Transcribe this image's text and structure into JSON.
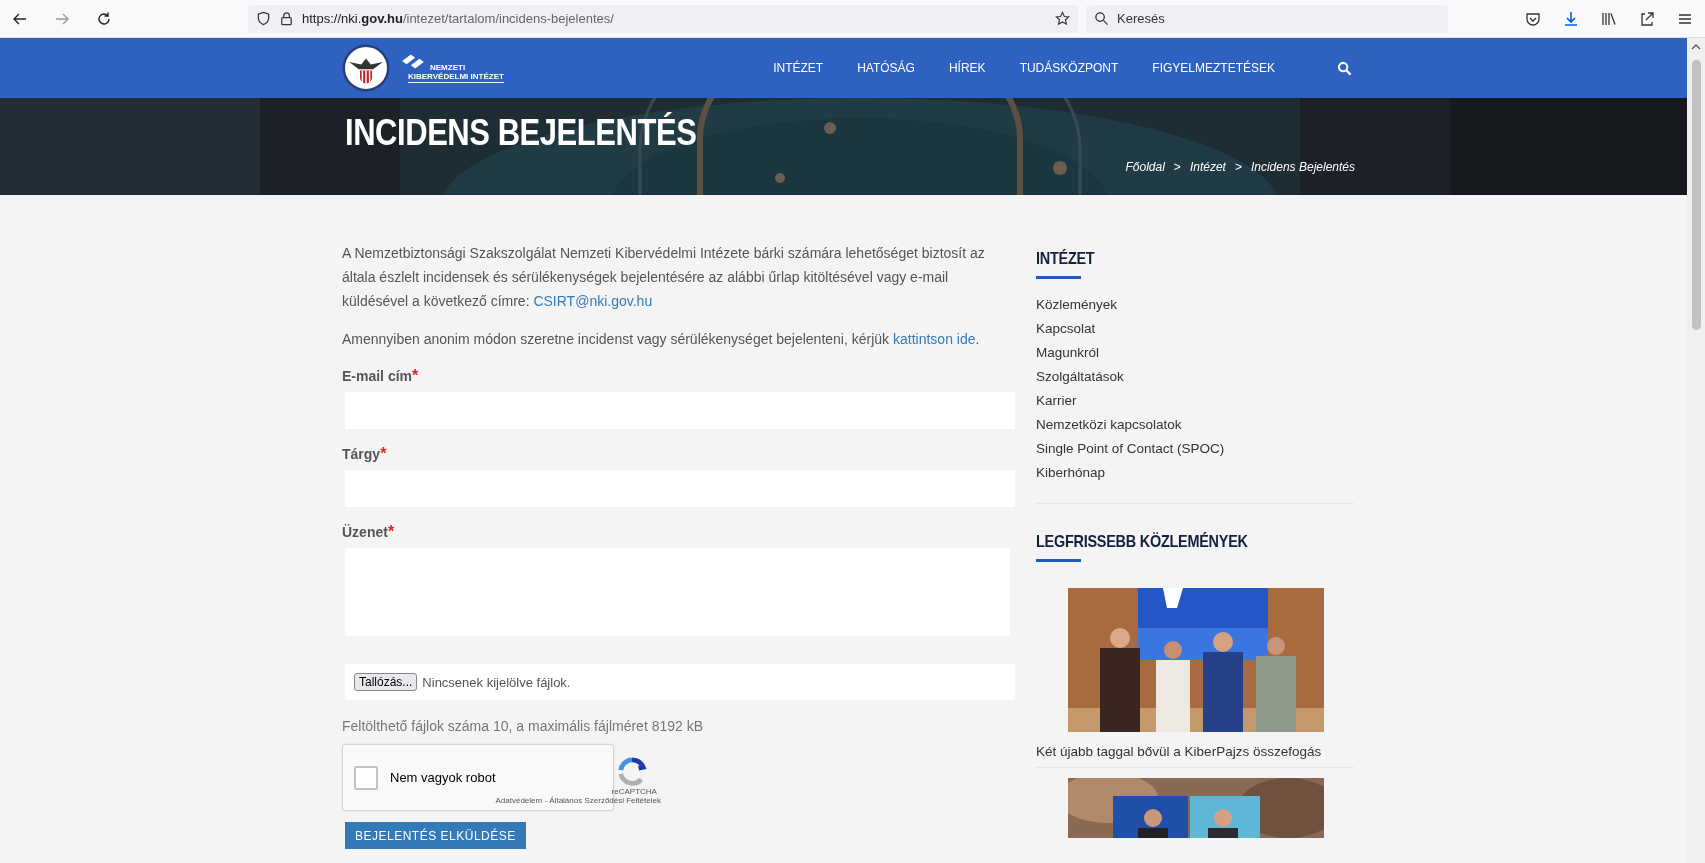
{
  "browser": {
    "url_prefix": "https://nki.",
    "url_domain": "gov.hu",
    "url_path": "/intezet/tartalom/incidens-bejelentes/",
    "search_placeholder": "Keresés"
  },
  "header": {
    "logo_lines": [
      "NEMZETI",
      "KIBERVÉDELMI INTÉZET"
    ],
    "nav": [
      {
        "label": "INTÉZET"
      },
      {
        "label": "HATÓSÁG"
      },
      {
        "label": "HÍREK"
      },
      {
        "label": "TUDÁSKÖZPONT"
      },
      {
        "label": "FIGYELMEZTETÉSEK"
      }
    ]
  },
  "hero": {
    "title": "INCIDENS BEJELENTÉS",
    "breadcrumbs": [
      "Főoldal",
      "Intézet",
      "Incidens Bejelentés"
    ],
    "separator": ">"
  },
  "intro": [
    {
      "text": "A Nemzetbiztonsági Szakszolgálat Nemzeti Kibervédelmi Intézete bárki számára lehetőséget biztosít az általa észlelt incidensek és sérülékenységek bejelentésére az alábbi űrlap kitöltésével vagy e-mail küldésével a következő címre: ",
      "link": "CSIRT@nki.gov.hu"
    },
    {
      "text": "Amennyiben anonim módon szeretne incidenst vagy sérülékenységet bejelenteni, kérjük ",
      "link": "kattintson ide",
      "after": "."
    }
  ],
  "required_mark": "*",
  "fields": [
    {
      "label": "E-mail cím",
      "required": true,
      "kind": "input"
    },
    {
      "label": "Tárgy",
      "required": true,
      "kind": "input"
    },
    {
      "label": "Üzenet",
      "required": true,
      "kind": "textarea"
    }
  ],
  "file_upload": {
    "button": "Tallózás...",
    "status": "Nincsenek kijelölve fájlok."
  },
  "upload_hint": "Feltölthető fájlok száma 10, a maximális fájlméret 8192 kB",
  "captcha": {
    "checked": false,
    "label": "Nem vagyok robot",
    "brand": "reCAPTCHA",
    "footer": "Adatvédelem - Általános Szerződési Feltételek"
  },
  "submit": "BEJELENTÉS ELKÜLDÉSE",
  "sidebar": {
    "menu_title": "INTÉZET",
    "menu": [
      "Közlemények",
      "Kapcsolat",
      "Magunkról",
      "Szolgáltatások",
      "Karrier",
      "Nemzetközi kapcsolatok",
      "Single Point of Contact (SPOC)",
      "Kiberhónap"
    ],
    "news_title": "LEGFRISSEBB KÖZLEMÉNYEK",
    "news": [
      {
        "kind": "picture",
        "caption": "Két újabb taggal bővül a KiberPajzs összefogás"
      },
      {
        "kind": "picture"
      }
    ]
  }
}
